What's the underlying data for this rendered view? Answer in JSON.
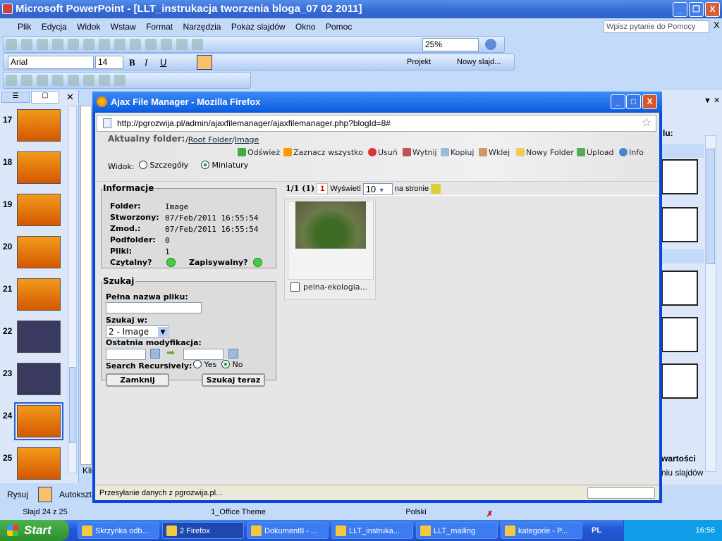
{
  "powerpoint": {
    "title": "Microsoft PowerPoint - [LLT_instrukacja tworzenia bloga_07 02 2011]",
    "menu": [
      "Plik",
      "Edycja",
      "Widok",
      "Wstaw",
      "Format",
      "Narzędzia",
      "Pokaz slajdów",
      "Okno",
      "Pomoc"
    ],
    "help_placeholder": "Wpisz pytanie do Pomocy",
    "zoom": "25%",
    "font": "Arial",
    "font_size": "14",
    "projekt": "Projekt",
    "nowy_slajd": "Nowy slajd...",
    "slides": [
      {
        "n": "17"
      },
      {
        "n": "18"
      },
      {
        "n": "19"
      },
      {
        "n": "20"
      },
      {
        "n": "21"
      },
      {
        "n": "22"
      },
      {
        "n": "23"
      },
      {
        "n": "24",
        "selected": true
      },
      {
        "n": "25"
      }
    ],
    "notes_text": "Kli",
    "right_pane": {
      "heading": "lu:",
      "footer1": "wartości",
      "footer2": "niu slajdów"
    },
    "draw_toolbar": {
      "rysuj": "Rysuj",
      "autoshapes": "Autokszta"
    },
    "status": {
      "slide": "Slajd 24 z 25",
      "theme": "1_Office Theme",
      "lang": "Polski"
    }
  },
  "firefox": {
    "title": "Ajax File Manager - Mozilla Firefox",
    "url": "http://pgrozwija.pl/admin/ajaxfilemanager/ajaxfilemanager.php?blogId=8#",
    "status": "Przesyłanie danych z pgrozwija.pl...",
    "fm": {
      "folder_label": "Aktualny folder:",
      "path_sep": "/",
      "root": "Root Folder",
      "current": "Image",
      "tools": [
        "Odśwież",
        "Zaznacz wszystko",
        "Usuń",
        "Wytnij",
        "Kopiuj",
        "Wklej",
        "Nowy Folder",
        "Upload",
        "Info"
      ],
      "view_label": "Widok:",
      "view_details": "Szczegóły",
      "view_thumbs": "Miniatury",
      "info": {
        "legend": "Informacje",
        "rows": [
          {
            "k": "Folder:",
            "v": "Image"
          },
          {
            "k": "Stworzony:",
            "v": "07/Feb/2011 16:55:54"
          },
          {
            "k": "Zmod.:",
            "v": "07/Feb/2011 16:55:54"
          },
          {
            "k": "Podfolder:",
            "v": "0"
          },
          {
            "k": "Pliki:",
            "v": "1"
          }
        ],
        "readable": "Czytalny?",
        "writable": "Zapisywalny?"
      },
      "search": {
        "legend": "Szukaj",
        "filename_label": "Pełna nazwa pliku:",
        "filename": "",
        "search_in_label": "Szukaj w:",
        "search_in": "2 - Image",
        "modified_label": "Ostatnia modyfikacja:",
        "recursive_label": "Search Recursively:",
        "yes": "Yes",
        "no": "No",
        "close": "Zamknij",
        "search_now": "Szukaj teraz"
      },
      "pager": {
        "info": "1/1 (1)",
        "page": "1",
        "show": "Wyświetl",
        "per_page": "10",
        "per_page_suffix": "na stronie"
      },
      "files": [
        {
          "name": "pelna-ekologia..."
        }
      ]
    }
  },
  "taskbar": {
    "start": "Start",
    "tasks": [
      "Skrzynka odb...",
      "2 Firefox",
      "Dokument8 - ...",
      "LLT_instruka...",
      "LLT_mailing",
      "kategorie - P..."
    ],
    "lang": "PL",
    "clock": "16:56"
  }
}
